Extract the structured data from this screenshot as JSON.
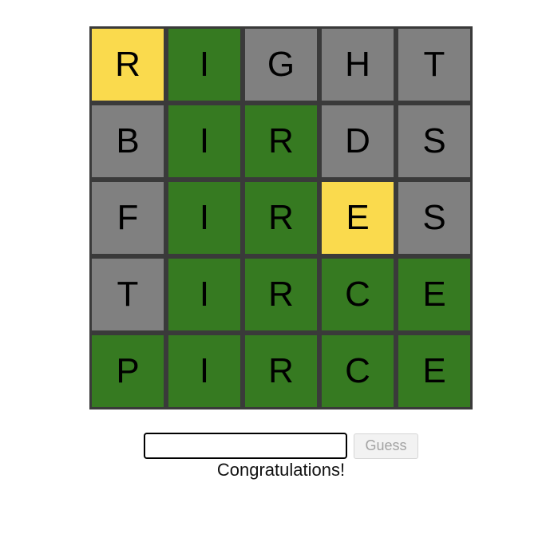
{
  "colors": {
    "correct": "#367a21",
    "present": "#fada4d",
    "absent": "#808080",
    "board_border": "#3a3a3a"
  },
  "board": [
    [
      {
        "letter": "R",
        "state": "present"
      },
      {
        "letter": "I",
        "state": "correct"
      },
      {
        "letter": "G",
        "state": "absent"
      },
      {
        "letter": "H",
        "state": "absent"
      },
      {
        "letter": "T",
        "state": "absent"
      }
    ],
    [
      {
        "letter": "B",
        "state": "absent"
      },
      {
        "letter": "I",
        "state": "correct"
      },
      {
        "letter": "R",
        "state": "correct"
      },
      {
        "letter": "D",
        "state": "absent"
      },
      {
        "letter": "S",
        "state": "absent"
      }
    ],
    [
      {
        "letter": "F",
        "state": "absent"
      },
      {
        "letter": "I",
        "state": "correct"
      },
      {
        "letter": "R",
        "state": "correct"
      },
      {
        "letter": "E",
        "state": "present"
      },
      {
        "letter": "S",
        "state": "absent"
      }
    ],
    [
      {
        "letter": "T",
        "state": "absent"
      },
      {
        "letter": "I",
        "state": "correct"
      },
      {
        "letter": "R",
        "state": "correct"
      },
      {
        "letter": "C",
        "state": "correct"
      },
      {
        "letter": "E",
        "state": "correct"
      }
    ],
    [
      {
        "letter": "P",
        "state": "correct"
      },
      {
        "letter": "I",
        "state": "correct"
      },
      {
        "letter": "R",
        "state": "correct"
      },
      {
        "letter": "C",
        "state": "correct"
      },
      {
        "letter": "E",
        "state": "correct"
      }
    ]
  ],
  "input": {
    "value": "",
    "placeholder": ""
  },
  "guess_button": {
    "label": "Guess",
    "disabled": true
  },
  "status_message": "Congratulations!"
}
